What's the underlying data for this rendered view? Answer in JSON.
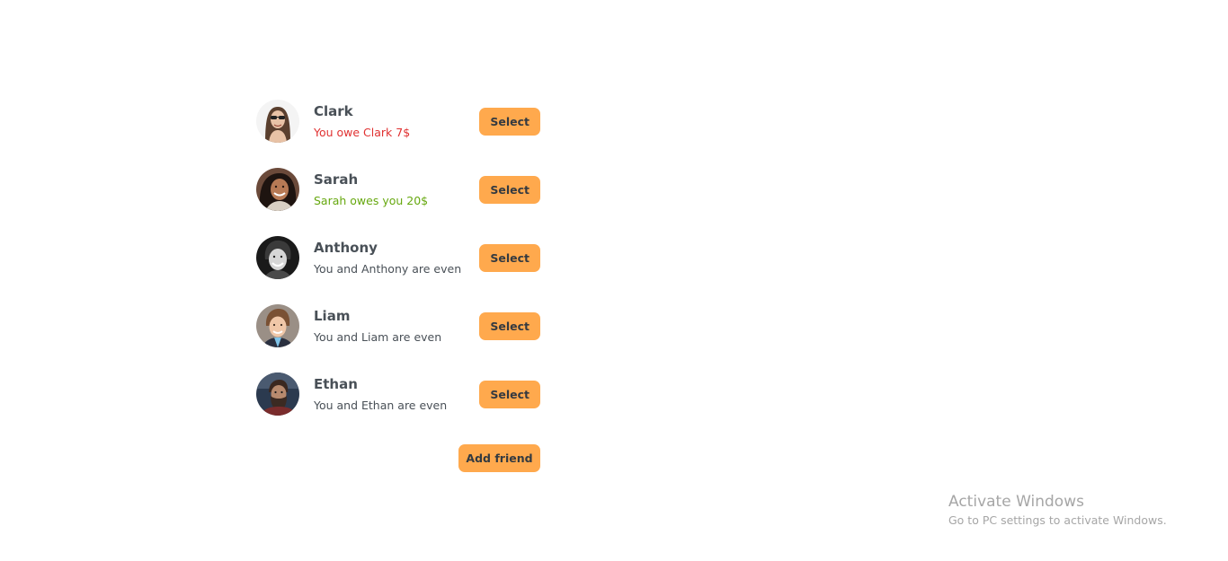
{
  "friends": [
    {
      "name": "Clark",
      "status": "You owe Clark 7$",
      "status_type": "negative",
      "button": "Select",
      "icon": "avatar-clark"
    },
    {
      "name": "Sarah",
      "status": "Sarah owes you 20$",
      "status_type": "positive",
      "button": "Select",
      "icon": "avatar-sarah"
    },
    {
      "name": "Anthony",
      "status": "You and Anthony are even",
      "status_type": "even",
      "button": "Select",
      "icon": "avatar-anthony"
    },
    {
      "name": "Liam",
      "status": "You and Liam are even",
      "status_type": "even",
      "button": "Select",
      "icon": "avatar-liam"
    },
    {
      "name": "Ethan",
      "status": "You and Ethan are even",
      "status_type": "even",
      "button": "Select",
      "icon": "avatar-ethan"
    }
  ],
  "add_friend_label": "Add friend",
  "colors": {
    "button_bg": "#ffa94d",
    "negative": "#e03131",
    "positive": "#66a80f",
    "text": "#495057"
  },
  "watermark": {
    "title": "Activate Windows",
    "subtitle": "Go to PC settings to activate Windows."
  }
}
